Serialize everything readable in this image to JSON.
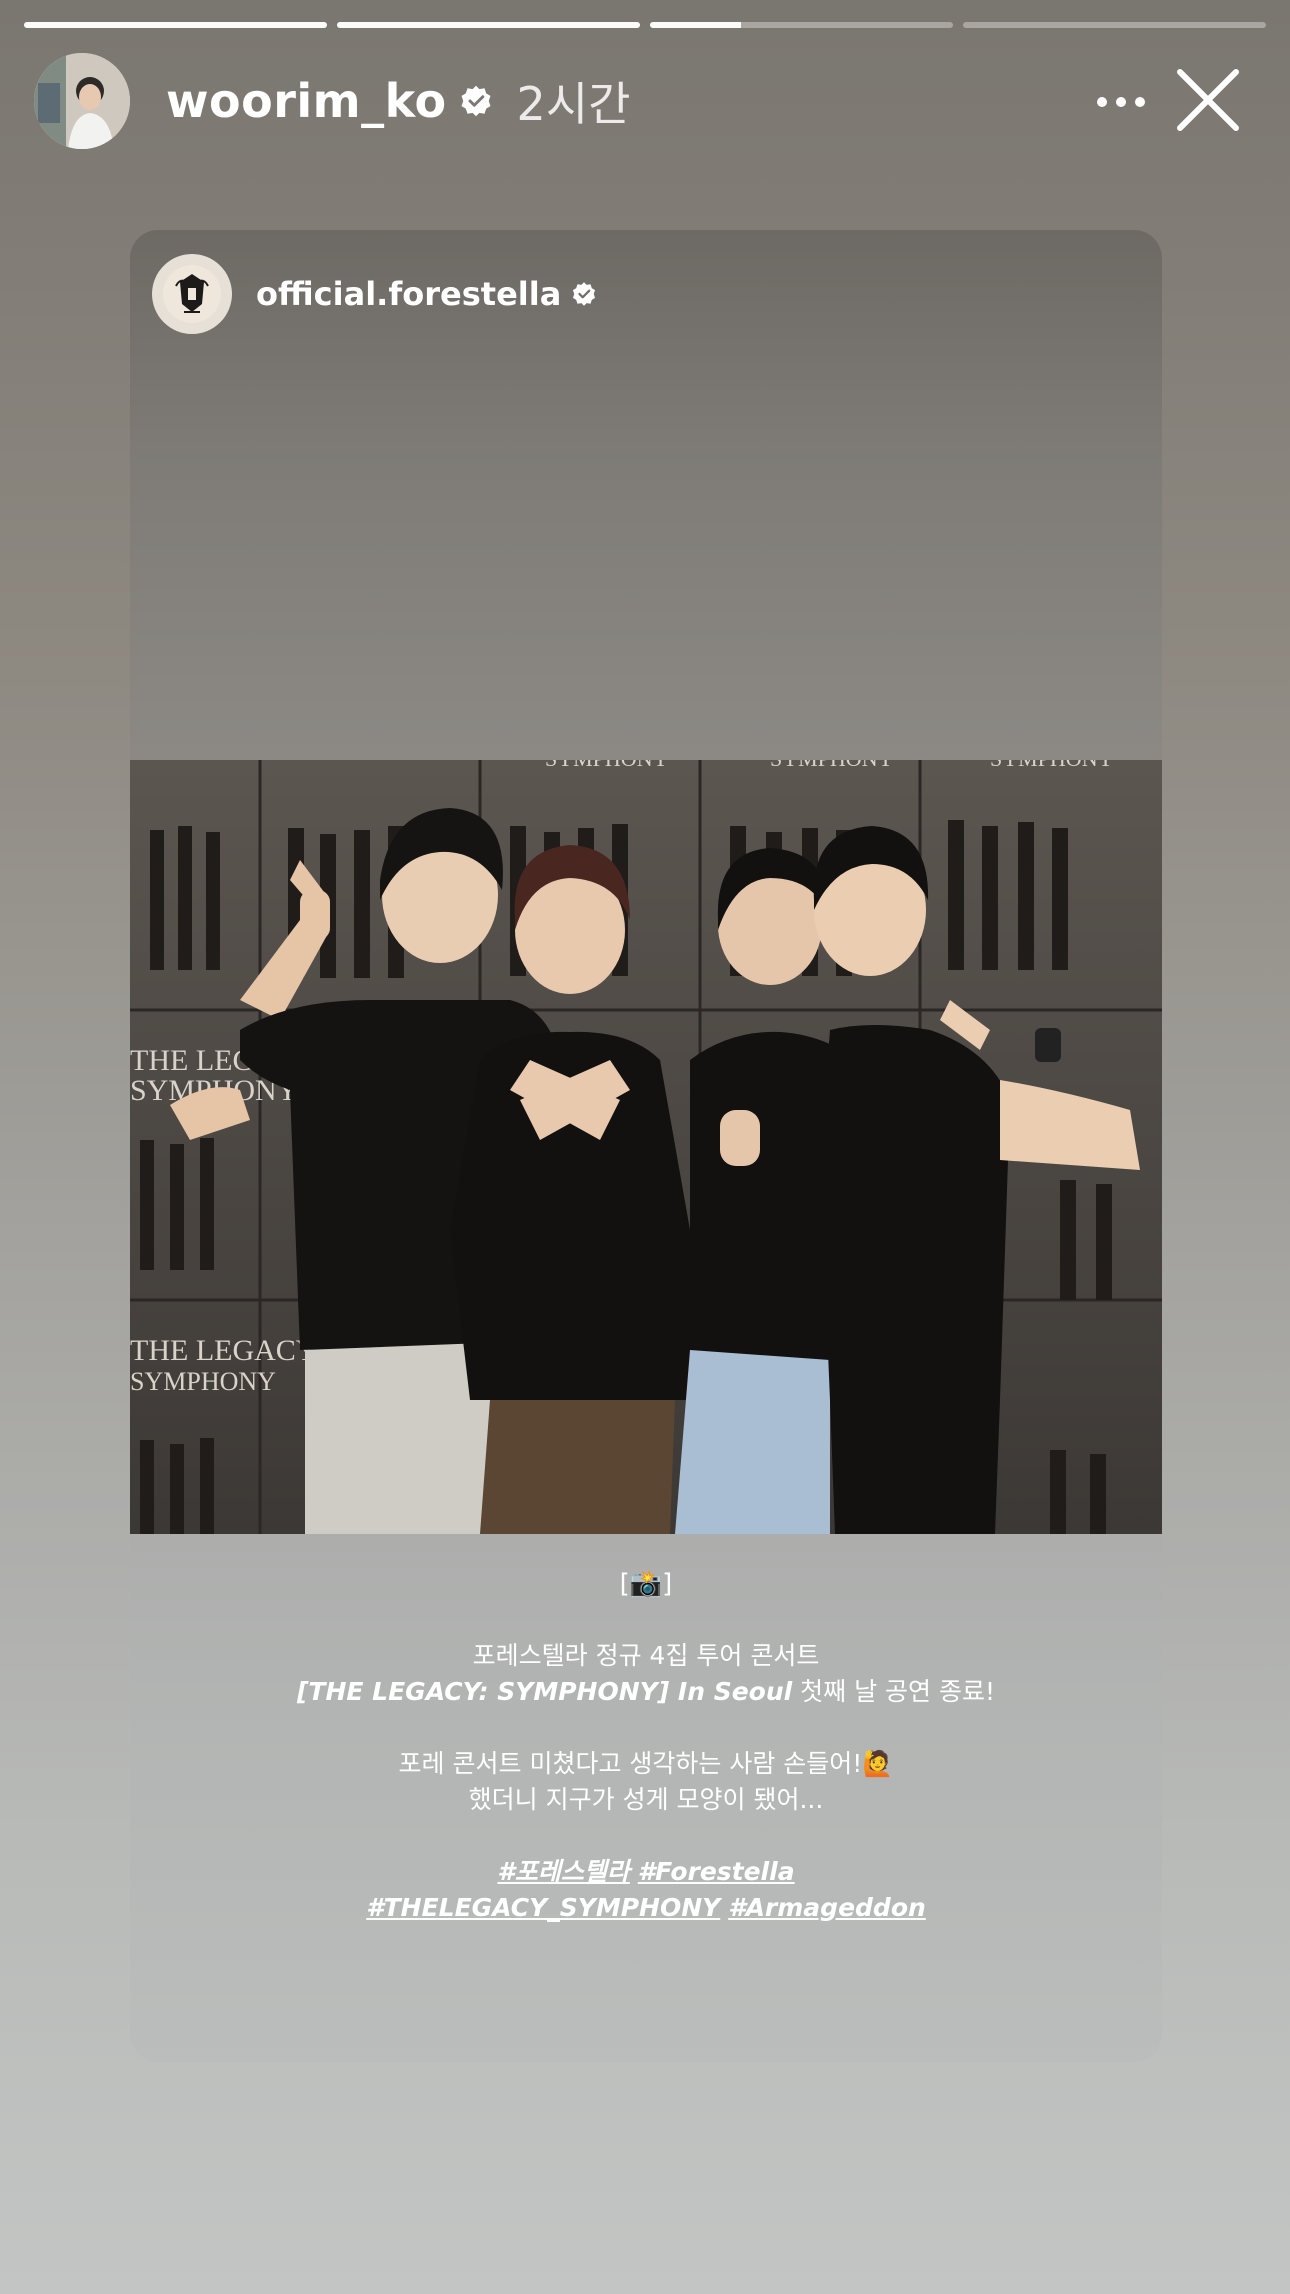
{
  "story": {
    "progress": [
      1.0,
      1.0,
      0.3,
      0.0
    ],
    "username": "woorim_ko",
    "time": "2시간",
    "more_icon": "more-horizontal-icon",
    "close_icon": "close-icon"
  },
  "shared_post": {
    "username": "official.forestella",
    "caption": {
      "emoji_line": "[📸]",
      "line1": "포레스텔라 정규 4집 투어 콘서트",
      "line2_bold": "[THE LEGACY: SYMPHONY] In Seoul",
      "line2_rest": " 첫째 날 공연 종료!",
      "line3": "포레 콘서트 미쳤다고 생각하는 사람 손들어!🙋",
      "line4": "했더니 지구가 성게 모양이 됐어...",
      "tags_line1": [
        "#포레스텔라",
        "#Forestella"
      ],
      "tags_line2": [
        "#THELEGACY_SYMPHONY",
        "#Armageddon"
      ]
    },
    "photo_poster_text": [
      "SYMPHONY",
      "THE LEGACY",
      "SYMPHONY"
    ]
  }
}
